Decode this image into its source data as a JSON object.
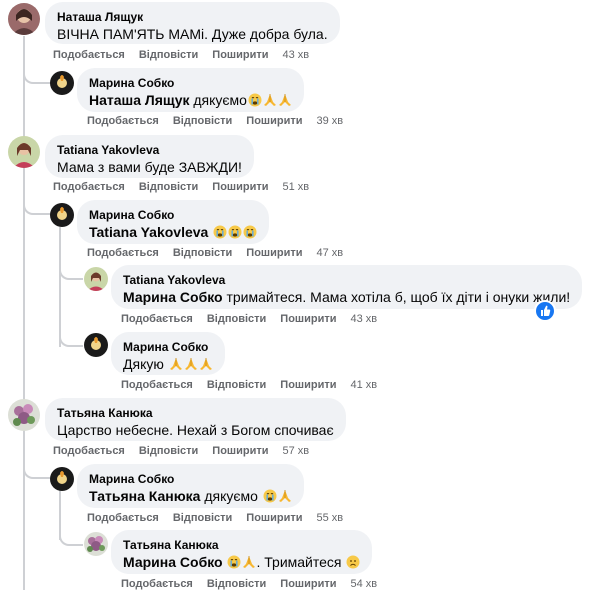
{
  "actions": {
    "like": "Подобається",
    "reply": "Відповісти",
    "share": "Поширити"
  },
  "comments": [
    {
      "author": "Наташа Лящук",
      "text": "ВІЧНА ПАМ'ЯТЬ МАМі. Дуже добра була.",
      "time": "43 хв",
      "avatar": "avatar-natasha"
    },
    {
      "author": "Марина Собко",
      "mention": "Наташа Лящук",
      "text": " дякуємо",
      "emoji": [
        "crying-face",
        "praying-hands",
        "praying-hands"
      ],
      "time": "39 хв",
      "avatar": "avatar-maryna"
    },
    {
      "author": "Tatiana Yakovleva",
      "text": "Мама з вами буде ЗАВЖДИ!",
      "time": "51 хв",
      "avatar": "avatar-tatiana"
    },
    {
      "author": "Марина Собко",
      "mention": "Tatiana Yakovleva",
      "text": " ",
      "emoji": [
        "crying-face",
        "crying-face",
        "crying-face"
      ],
      "time": "47 хв",
      "avatar": "avatar-maryna"
    },
    {
      "author": "Tatiana Yakovleva",
      "mention": "Марина Собко",
      "text": " тримайтеся. Мама хотіла б, щоб їх діти і онуки жили!",
      "time": "43 хв",
      "avatar": "avatar-tatiana",
      "reaction": "like"
    },
    {
      "author": "Марина Собко",
      "text": "Дякую ",
      "emoji": [
        "praying-hands",
        "praying-hands",
        "praying-hands"
      ],
      "time": "41 хв",
      "avatar": "avatar-maryna"
    },
    {
      "author": "Татьяна Канюка",
      "text": "Царство небесне. Нехай з Богом спочиває",
      "time": "57 хв",
      "avatar": "avatar-tatyana-k"
    },
    {
      "author": "Марина Собко",
      "mention": "Татьяна Канюка",
      "text": " дякуємо ",
      "emoji": [
        "crying-face",
        "praying-hands"
      ],
      "time": "55 хв",
      "avatar": "avatar-maryna"
    },
    {
      "author": "Татьяна Канюка",
      "mention": "Марина Собко",
      "text": " ",
      "emoji": [
        "crying-face",
        "praying-hands"
      ],
      "text2": ". Тримайтеся ",
      "emoji2": [
        "sad-face"
      ],
      "time": "54 хв",
      "avatar": "avatar-tatyana-k"
    }
  ],
  "colors": {
    "link": "#65676b",
    "bubble": "#f0f2f5",
    "thread_line": "#ced0d4",
    "like_badge": "#1877f2"
  }
}
